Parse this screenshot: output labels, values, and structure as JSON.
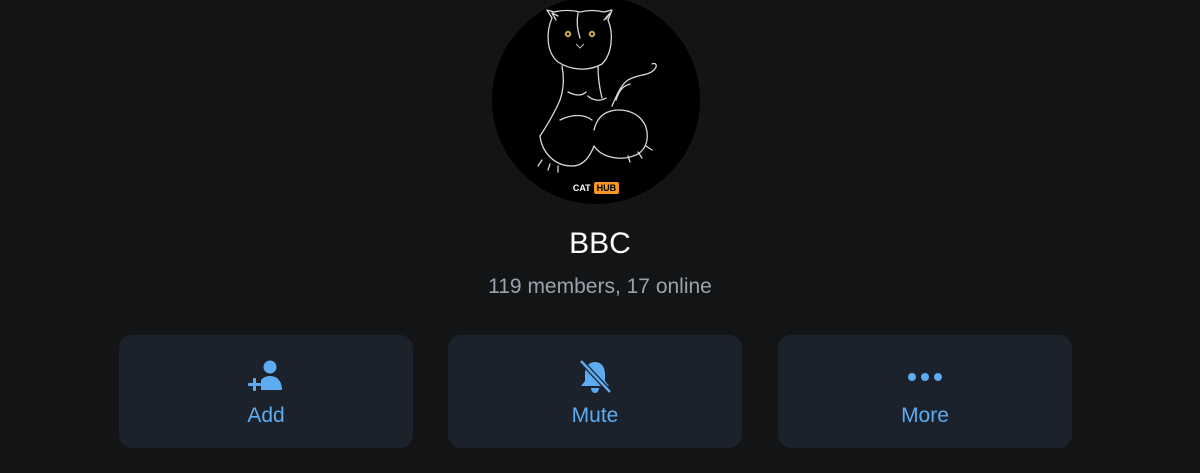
{
  "group": {
    "name": "BBC",
    "status": "119 members, 17 online"
  },
  "avatar": {
    "brand_left": "CAT",
    "brand_right": "HUB",
    "brand_color": "#f7971d"
  },
  "actions": [
    {
      "label": "Add",
      "icon": "add-user-icon"
    },
    {
      "label": "Mute",
      "icon": "bell-muted-icon"
    },
    {
      "label": "More",
      "icon": "more-dots-icon"
    }
  ],
  "colors": {
    "background": "#131416",
    "card": "#1b222b",
    "accent": "#5eabef",
    "title": "#ffffff",
    "subtitle": "#9aa3ad"
  }
}
